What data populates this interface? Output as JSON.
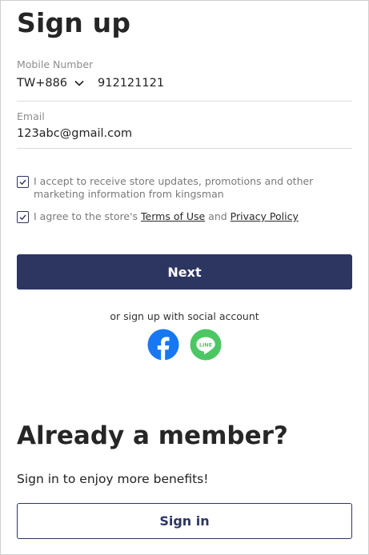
{
  "signup": {
    "title": "Sign up",
    "mobile": {
      "label": "Mobile Number",
      "country_code": "TW+886",
      "value": "912121121"
    },
    "email": {
      "label": "Email",
      "value": "123abc@gmail.com"
    },
    "consent_marketing": {
      "checked": true,
      "text": "I accept to receive store updates, promotions and other marketing information from kingsman"
    },
    "consent_terms": {
      "checked": true,
      "prefix": "I agree to the store's ",
      "terms_link": "Terms of Use",
      "middle": " and ",
      "privacy_link": "Privacy Policy"
    },
    "next_label": "Next",
    "social_text": "or sign up with social account",
    "social_icons": [
      "facebook-icon",
      "line-icon"
    ]
  },
  "member": {
    "title": "Already a member?",
    "subtitle": "Sign in to enjoy more benefits!",
    "signin_label": "Sign in"
  },
  "colors": {
    "primary": "#2d3561",
    "facebook": "#1877f2",
    "line": "#4cc764"
  }
}
